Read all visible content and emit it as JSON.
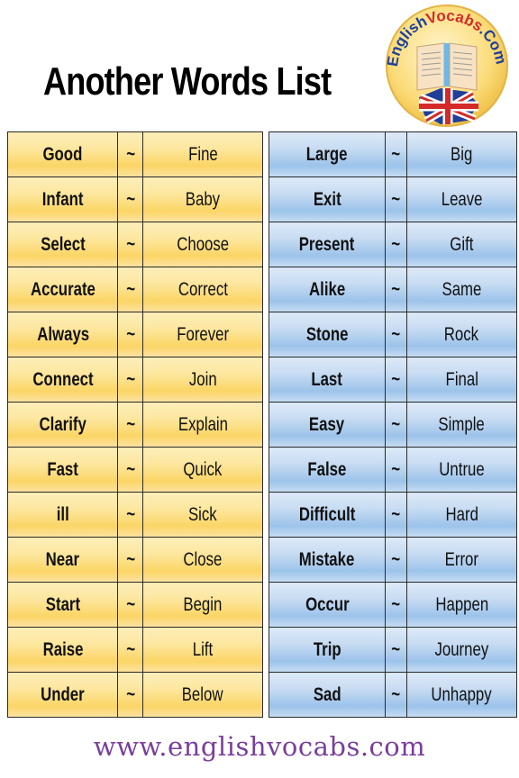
{
  "title": "Another Words List",
  "logo": {
    "text_left": "English",
    "text_right": "Vocabs",
    "text_suffix": ".Com",
    "icon": "book-and-uk-flag-icon"
  },
  "separator": "~",
  "left_table": [
    {
      "word": "Good",
      "synonym": "Fine"
    },
    {
      "word": "Infant",
      "synonym": "Baby"
    },
    {
      "word": "Select",
      "synonym": "Choose"
    },
    {
      "word": "Accurate",
      "synonym": "Correct"
    },
    {
      "word": "Always",
      "synonym": "Forever"
    },
    {
      "word": "Connect",
      "synonym": "Join"
    },
    {
      "word": "Clarify",
      "synonym": "Explain"
    },
    {
      "word": "Fast",
      "synonym": "Quick"
    },
    {
      "word": "ill",
      "synonym": "Sick"
    },
    {
      "word": "Near",
      "synonym": "Close"
    },
    {
      "word": "Start",
      "synonym": "Begin"
    },
    {
      "word": "Raise",
      "synonym": "Lift"
    },
    {
      "word": "Under",
      "synonym": "Below"
    }
  ],
  "right_table": [
    {
      "word": "Large",
      "synonym": "Big"
    },
    {
      "word": "Exit",
      "synonym": "Leave"
    },
    {
      "word": "Present",
      "synonym": "Gift"
    },
    {
      "word": "Alike",
      "synonym": "Same"
    },
    {
      "word": "Stone",
      "synonym": "Rock"
    },
    {
      "word": "Last",
      "synonym": "Final"
    },
    {
      "word": "Easy",
      "synonym": "Simple"
    },
    {
      "word": "False",
      "synonym": "Untrue"
    },
    {
      "word": "Difficult",
      "synonym": "Hard"
    },
    {
      "word": "Mistake",
      "synonym": "Error"
    },
    {
      "word": "Occur",
      "synonym": "Happen"
    },
    {
      "word": "Trip",
      "synonym": "Journey"
    },
    {
      "word": "Sad",
      "synonym": "Unhappy"
    }
  ],
  "footer": "www.englishvocabs.com",
  "colors": {
    "left_table": "#fbd566",
    "right_table": "#9cc3ea",
    "footer": "#7a3e9d",
    "logo_blue": "#1f3f9a",
    "logo_red": "#d42a2a"
  }
}
